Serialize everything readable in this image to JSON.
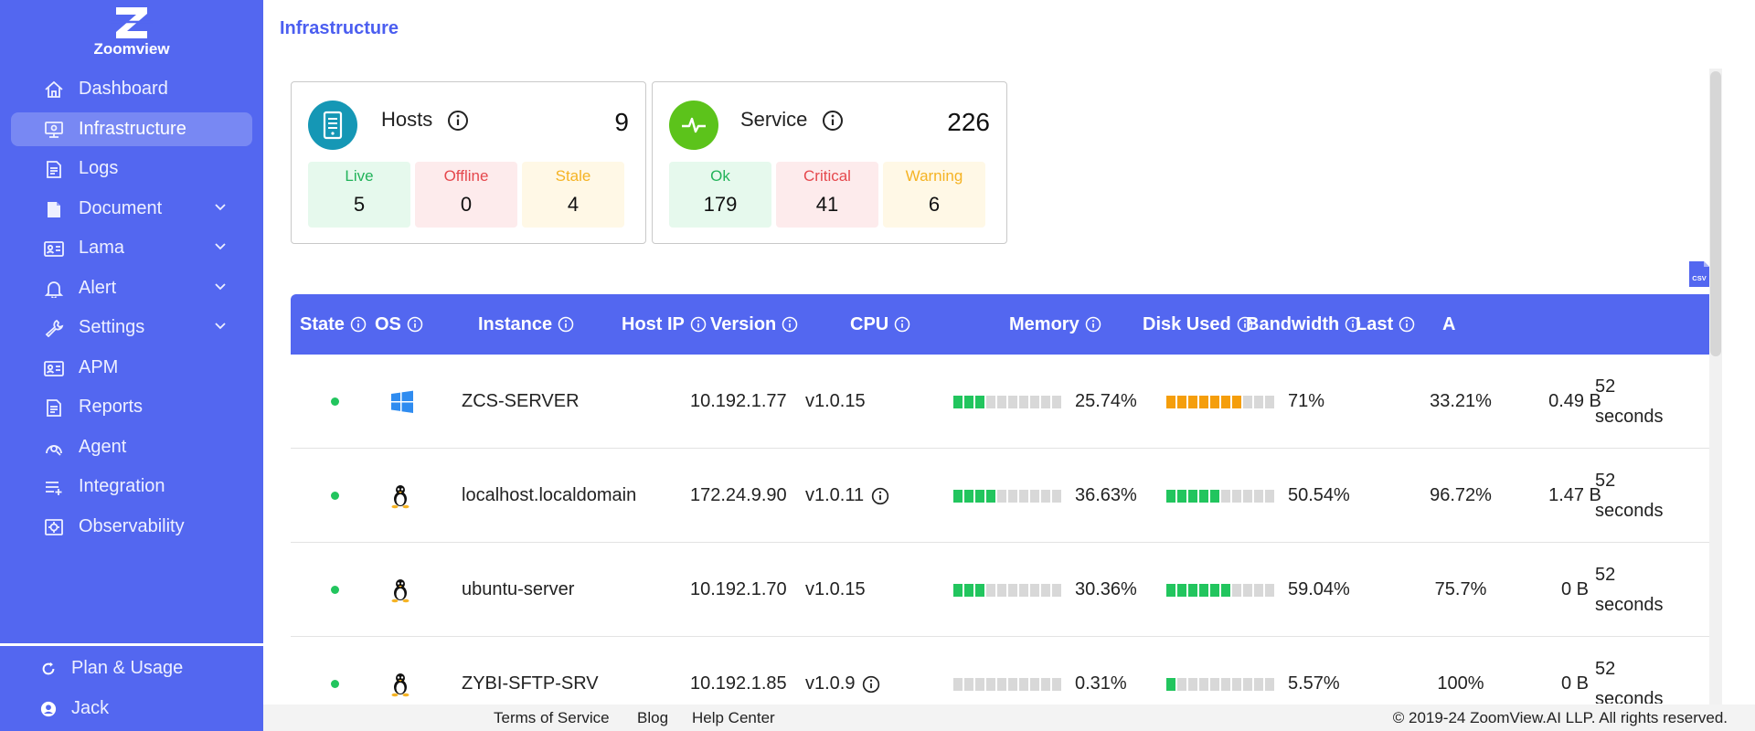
{
  "app": {
    "name": "Zoomview"
  },
  "sidebar": {
    "items": [
      {
        "label": "Dashboard",
        "icon": "home-icon",
        "active": false,
        "chevron": false
      },
      {
        "label": "Infrastructure",
        "icon": "monitor-icon",
        "active": true,
        "chevron": false
      },
      {
        "label": "Logs",
        "icon": "file-icon",
        "active": false,
        "chevron": false
      },
      {
        "label": "Document",
        "icon": "document-icon",
        "active": false,
        "chevron": true
      },
      {
        "label": "Lama",
        "icon": "id-card-icon",
        "active": false,
        "chevron": true
      },
      {
        "label": "Alert",
        "icon": "bell-icon",
        "active": false,
        "chevron": true
      },
      {
        "label": "Settings",
        "icon": "wrench-icon",
        "active": false,
        "chevron": true
      },
      {
        "label": "APM",
        "icon": "id-card-icon",
        "active": false,
        "chevron": false
      },
      {
        "label": "Reports",
        "icon": "file-icon",
        "active": false,
        "chevron": false
      },
      {
        "label": "Agent",
        "icon": "agent-icon",
        "active": false,
        "chevron": false
      },
      {
        "label": "Integration",
        "icon": "integration-icon",
        "active": false,
        "chevron": false
      },
      {
        "label": "Observability",
        "icon": "observability-icon",
        "active": false,
        "chevron": false
      }
    ],
    "plan_label": "Plan & Usage",
    "user_label": "Jack"
  },
  "page": {
    "title": "Infrastructure"
  },
  "hosts_card": {
    "title": "Hosts",
    "total": "9",
    "stats": [
      {
        "label": "Live",
        "value": "5"
      },
      {
        "label": "Offline",
        "value": "0"
      },
      {
        "label": "Stale",
        "value": "4"
      }
    ]
  },
  "service_card": {
    "title": "Service",
    "total": "226",
    "stats": [
      {
        "label": "Ok",
        "value": "179"
      },
      {
        "label": "Critical",
        "value": "41"
      },
      {
        "label": "Warning",
        "value": "6"
      }
    ]
  },
  "colors": {
    "accent": "#5367f0",
    "live_bg": "#e6f9ed",
    "live_fg": "#22b35a",
    "offline_bg": "#fdebec",
    "offline_fg": "#e5484d",
    "stale_bg": "#fff8e6",
    "stale_fg": "#f5b324",
    "bar_green": "#22c55e",
    "bar_orange": "#f59e0b",
    "bar_empty": "#d8d8d8"
  },
  "table": {
    "columns": [
      "State",
      "OS",
      "Instance",
      "Host IP",
      "Version",
      "CPU",
      "Memory",
      "Disk Used",
      "Bandwidth",
      "Last",
      "A"
    ],
    "rows": [
      {
        "state": "online",
        "os": "windows-icon",
        "instance": "ZCS-SERVER",
        "host_ip": "10.192.1.77",
        "version": "v1.0.15",
        "version_info": false,
        "cpu": "25.74%",
        "cpu_pct": 25.74,
        "cpu_color": "green",
        "memory": "71%",
        "memory_pct": 71,
        "memory_color": "orange",
        "disk": "33.21%",
        "bandwidth": "0.49 B",
        "last": "52 seconds"
      },
      {
        "state": "online",
        "os": "linux-icon",
        "instance": "localhost.localdomain",
        "host_ip": "172.24.9.90",
        "version": "v1.0.11",
        "version_info": true,
        "cpu": "36.63%",
        "cpu_pct": 36.63,
        "cpu_color": "green",
        "memory": "50.54%",
        "memory_pct": 50.54,
        "memory_color": "green",
        "disk": "96.72%",
        "bandwidth": "1.47 B",
        "last": "52 seconds"
      },
      {
        "state": "online",
        "os": "linux-icon",
        "instance": "ubuntu-server",
        "host_ip": "10.192.1.70",
        "version": "v1.0.15",
        "version_info": false,
        "cpu": "30.36%",
        "cpu_pct": 30.36,
        "cpu_color": "green",
        "memory": "59.04%",
        "memory_pct": 59.04,
        "memory_color": "green",
        "disk": "75.7%",
        "bandwidth": "0 B",
        "last": "52 seconds"
      },
      {
        "state": "online",
        "os": "linux-icon",
        "instance": "ZYBI-SFTP-SRV",
        "host_ip": "10.192.1.85",
        "version": "v1.0.9",
        "version_info": true,
        "cpu": "0.31%",
        "cpu_pct": 0.31,
        "cpu_color": "green",
        "memory": "5.57%",
        "memory_pct": 5.57,
        "memory_color": "green",
        "disk": "100%",
        "bandwidth": "0 B",
        "last": "52 seconds"
      }
    ]
  },
  "footer": {
    "links": [
      "Terms of Service",
      "Blog",
      "Help Center"
    ],
    "copyright": "© 2019-24 ZoomView.AI LLP. All rights reserved."
  }
}
